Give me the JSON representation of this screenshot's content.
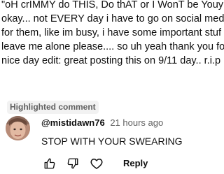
{
  "parent_comment": {
    "lines": [
      "\"oH crIMMY do THIS, Do thAT or I WonT be YouyF",
      "okay... not EVERY day i have to go on social media",
      "for them, like im busy, i have some important stuf",
      "leave me alone please.... so uh yeah thank you for",
      "nice day edit: great posting this on 9/11 day.. r.i.p"
    ]
  },
  "highlighted_comment": {
    "label": "Highlighted comment",
    "username": "@mistidawn76",
    "timestamp": "21 hours ago",
    "text": "STOP WITH YOUR SWEARING",
    "actions": {
      "like_icon": "thumbs-up-icon",
      "dislike_icon": "thumbs-down-icon",
      "heart_icon": "heart-icon",
      "reply_label": "Reply"
    }
  },
  "colors": {
    "text_primary": "#0f0f0f",
    "text_secondary": "#606060",
    "label_background": "#f2f2f2"
  }
}
